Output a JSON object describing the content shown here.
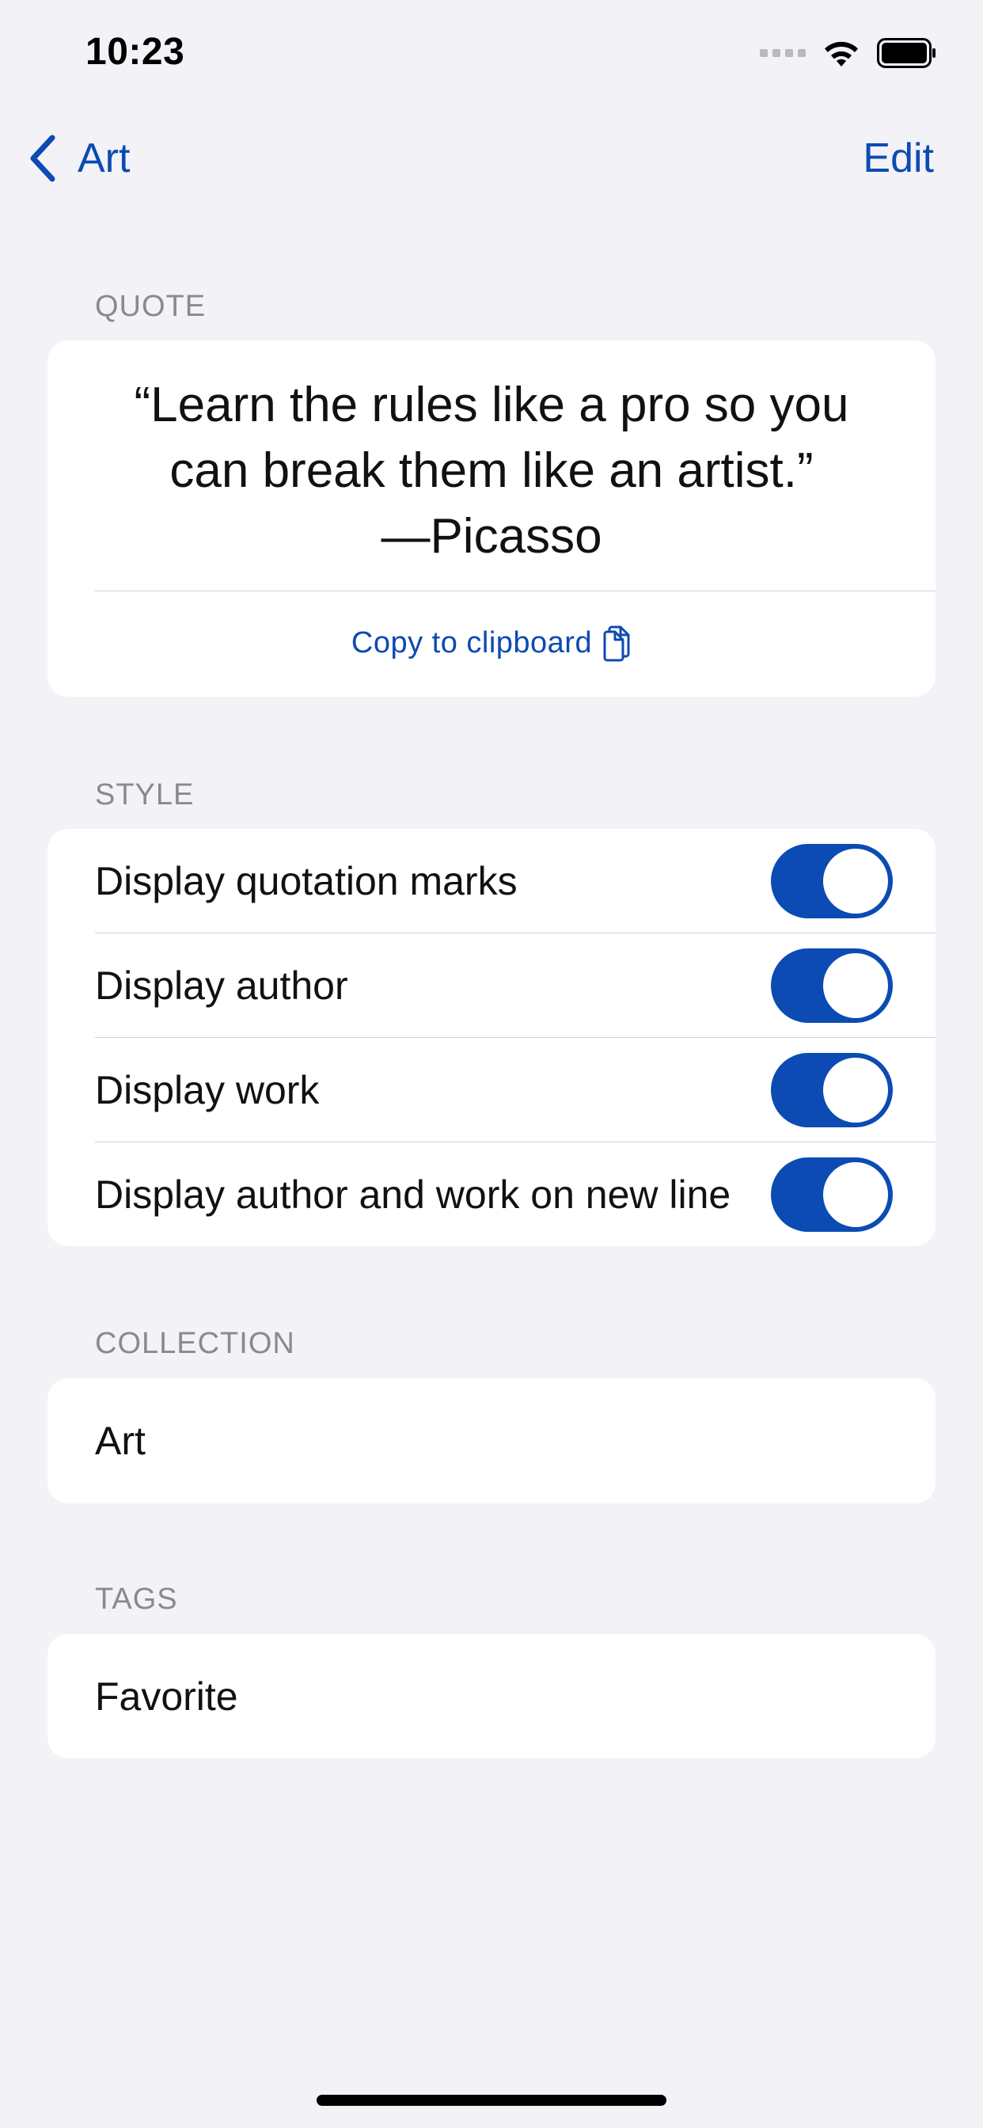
{
  "status_bar": {
    "time": "10:23",
    "icons": [
      "signal-icon",
      "wifi-icon",
      "battery-icon"
    ]
  },
  "nav": {
    "back_label": "Art",
    "edit_label": "Edit"
  },
  "quote_section": {
    "header": "QUOTE",
    "quote_line1": "“Learn the rules like a pro so you",
    "quote_line2": "can break them like an artist.”",
    "quote_line3": "—Picasso",
    "copy_label": "Copy to clipboard"
  },
  "style_section": {
    "header": "STYLE",
    "toggles": [
      {
        "label": "Display quotation marks",
        "on": true
      },
      {
        "label": "Display author",
        "on": true
      },
      {
        "label": "Display work",
        "on": true
      },
      {
        "label": "Display author and work on new line",
        "on": true
      }
    ]
  },
  "collection_section": {
    "header": "COLLECTION",
    "value": "Art"
  },
  "tags_section": {
    "header": "TAGS",
    "value": "Favorite"
  },
  "colors": {
    "accent": "#0b4bb3",
    "background": "#f2f2f7",
    "card": "#ffffff",
    "secondary_text": "#8a8a8e"
  }
}
